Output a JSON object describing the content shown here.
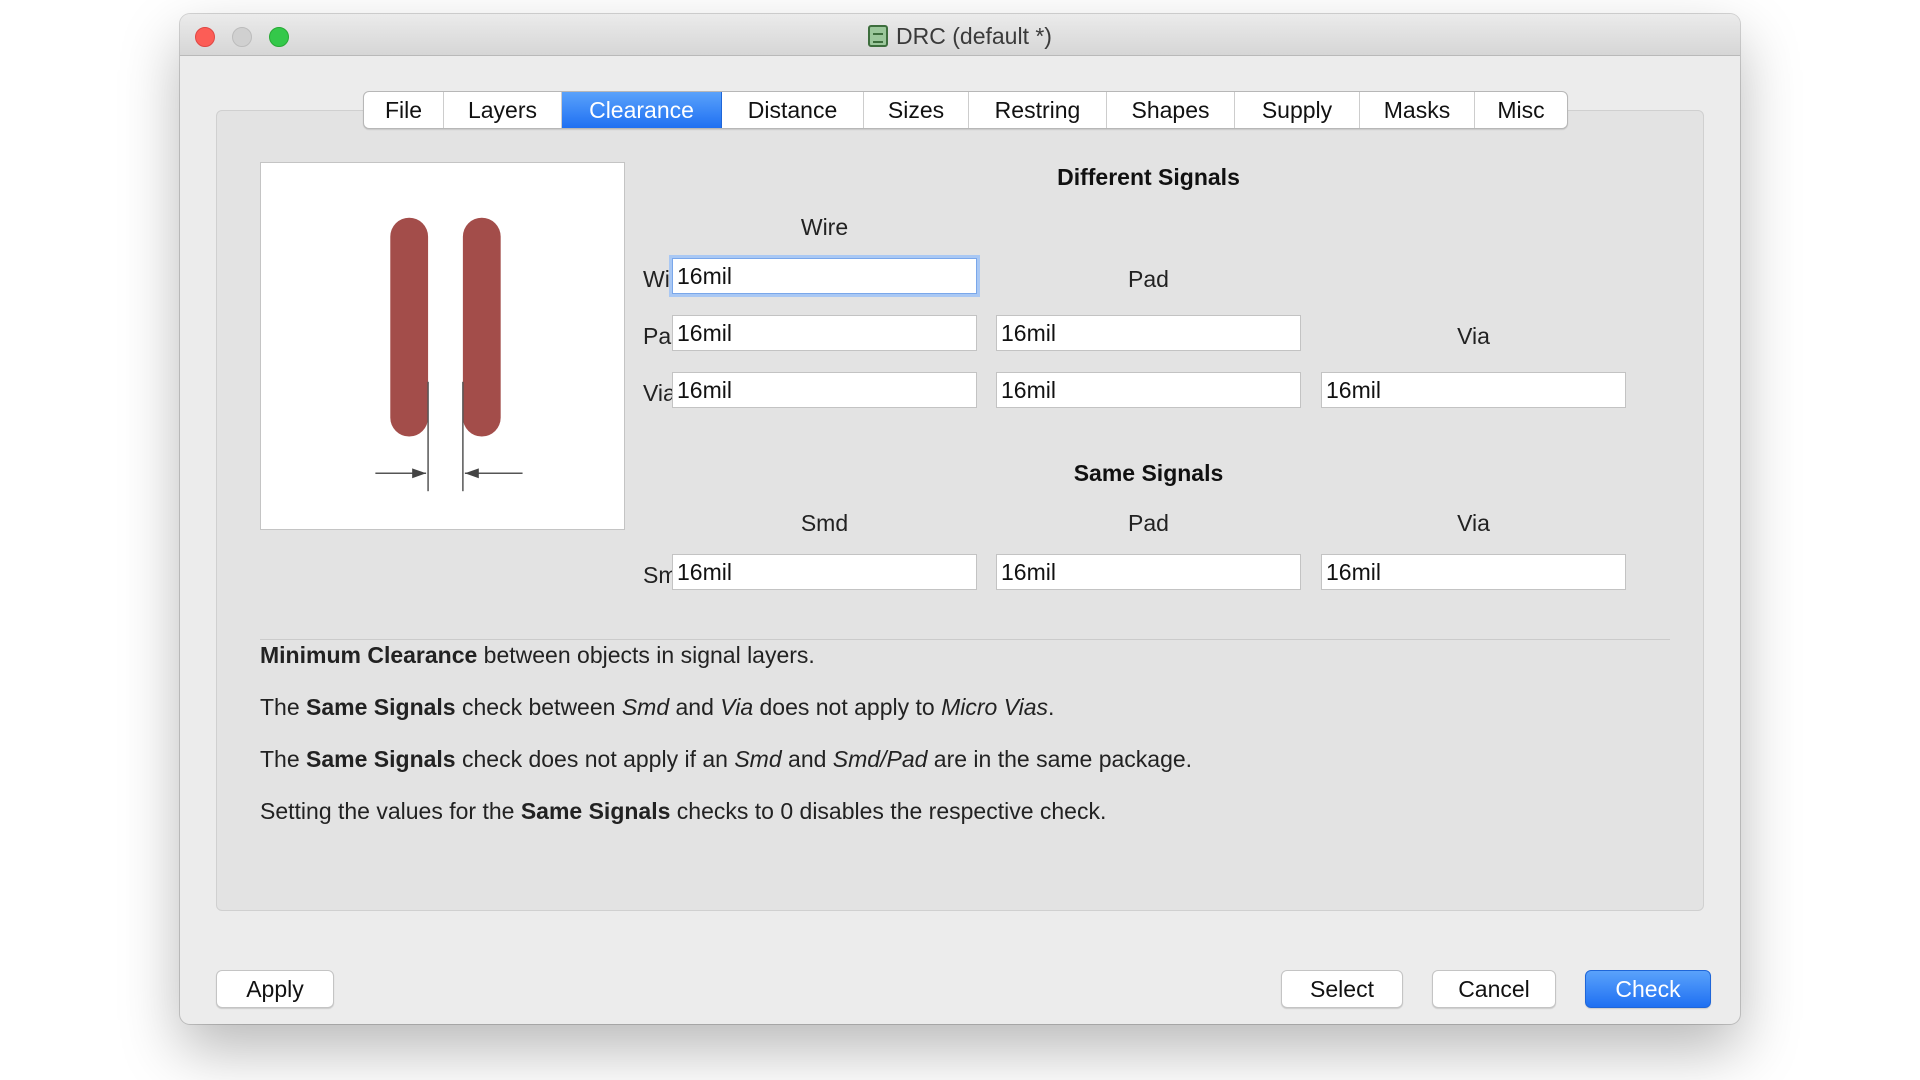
{
  "window": {
    "title": "DRC (default *)"
  },
  "tabs": [
    {
      "label": "File"
    },
    {
      "label": "Layers"
    },
    {
      "label": "Clearance",
      "active": true
    },
    {
      "label": "Distance"
    },
    {
      "label": "Sizes"
    },
    {
      "label": "Restring"
    },
    {
      "label": "Shapes"
    },
    {
      "label": "Supply"
    },
    {
      "label": "Masks"
    },
    {
      "label": "Misc"
    }
  ],
  "different_signals": {
    "heading": "Different Signals",
    "col_wire": "Wire",
    "col_pad": "Pad",
    "col_via": "Via",
    "row_wire": "Wire",
    "row_pad": "Pad",
    "row_via": "Via",
    "wire_wire": "16mil",
    "pad_wire": "16mil",
    "pad_pad": "16mil",
    "via_wire": "16mil",
    "via_pad": "16mil",
    "via_via": "16mil"
  },
  "same_signals": {
    "heading": "Same Signals",
    "col_smd": "Smd",
    "col_pad": "Pad",
    "col_via": "Via",
    "row_smd": "Smd",
    "smd_smd": "16mil",
    "smd_pad": "16mil",
    "smd_via": "16mil"
  },
  "help": {
    "line1": {
      "b1": "Minimum Clearance",
      "t1": " between objects in signal layers."
    },
    "line2": {
      "t1": "The ",
      "b1": "Same Signals",
      "t2": " check between ",
      "i1": "Smd",
      "t3": " and ",
      "i2": "Via",
      "t4": " does not apply to ",
      "i3": "Micro Vias",
      "t5": "."
    },
    "line3": {
      "t1": "The ",
      "b1": "Same Signals",
      "t2": " check does not apply if an ",
      "i1": "Smd",
      "t3": " and ",
      "i2": "Smd/Pad",
      "t4": " are in the same package."
    },
    "line4": {
      "t1": "Setting the values for the ",
      "b1": "Same Signals",
      "t2": " checks to 0 disables the respective check."
    }
  },
  "buttons": {
    "apply": "Apply",
    "select": "Select",
    "cancel": "Cancel",
    "check": "Check"
  },
  "colors": {
    "accent": "#1f70f2",
    "trace": "#a34d4a",
    "close": "#fc5d56",
    "maximize": "#34c84a"
  },
  "icons": {
    "title_icon": "drc-app-icon"
  }
}
